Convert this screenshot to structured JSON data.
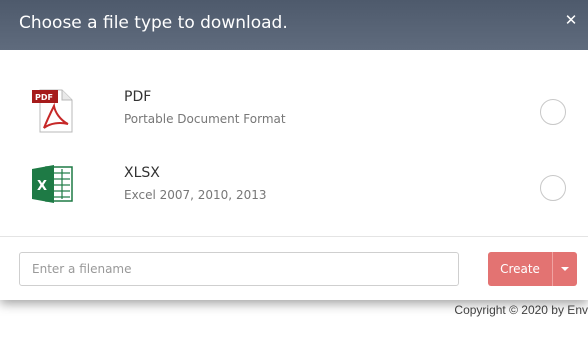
{
  "modal": {
    "title": "Choose a file type to download.",
    "close_symbol": "✕"
  },
  "options": [
    {
      "icon": "pdf-file-icon",
      "name": "PDF",
      "description": "Portable Document Format",
      "selected": false
    },
    {
      "icon": "excel-file-icon",
      "name": "XLSX",
      "description": "Excel 2007, 2010, 2013",
      "selected": false
    }
  ],
  "footer": {
    "filename_placeholder": "Enter a filename",
    "filename_value": "",
    "create_label": "Create"
  },
  "page": {
    "copyright": "Copyright © 2020 by Env"
  },
  "colors": {
    "header_bg": "#56626f",
    "create_button": "#e37372",
    "pdf_red": "#a61b1b",
    "excel_green": "#1e7a45"
  }
}
